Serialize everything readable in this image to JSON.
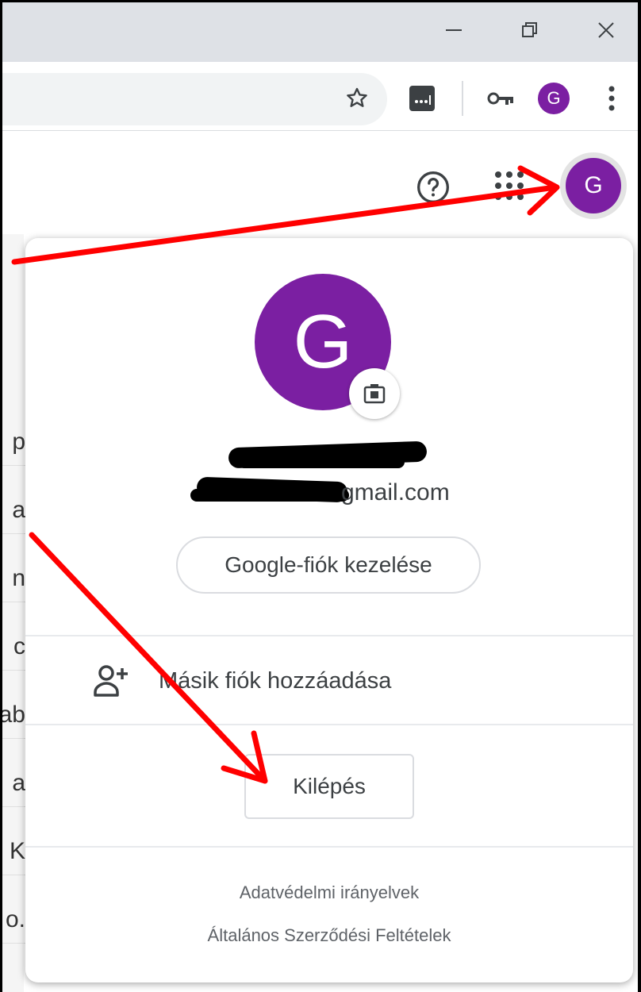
{
  "browser": {
    "window_controls": {
      "minimize_icon": "minimize-icon",
      "restore_icon": "restore-icon",
      "close_icon": "close-icon"
    },
    "toolbar": {
      "profile_initial": "G"
    }
  },
  "header": {
    "avatar_initial": "G"
  },
  "left_fragments": [
    "p",
    "a",
    "n",
    "c",
    "ab",
    "a",
    "K",
    "o."
  ],
  "account_popup": {
    "avatar_initial": "G",
    "email": "gmail.com",
    "manage_label": "Google-fiók kezelése",
    "add_account_label": "Másik fiók hozzáadása",
    "logout_label": "Kilépés",
    "privacy_label": "Adatvédelmi irányelvek",
    "terms_label": "Általános Szerződési Feltételek"
  },
  "colors": {
    "avatar": "#7b1fa2",
    "annotation_arrow": "#ff0000"
  }
}
